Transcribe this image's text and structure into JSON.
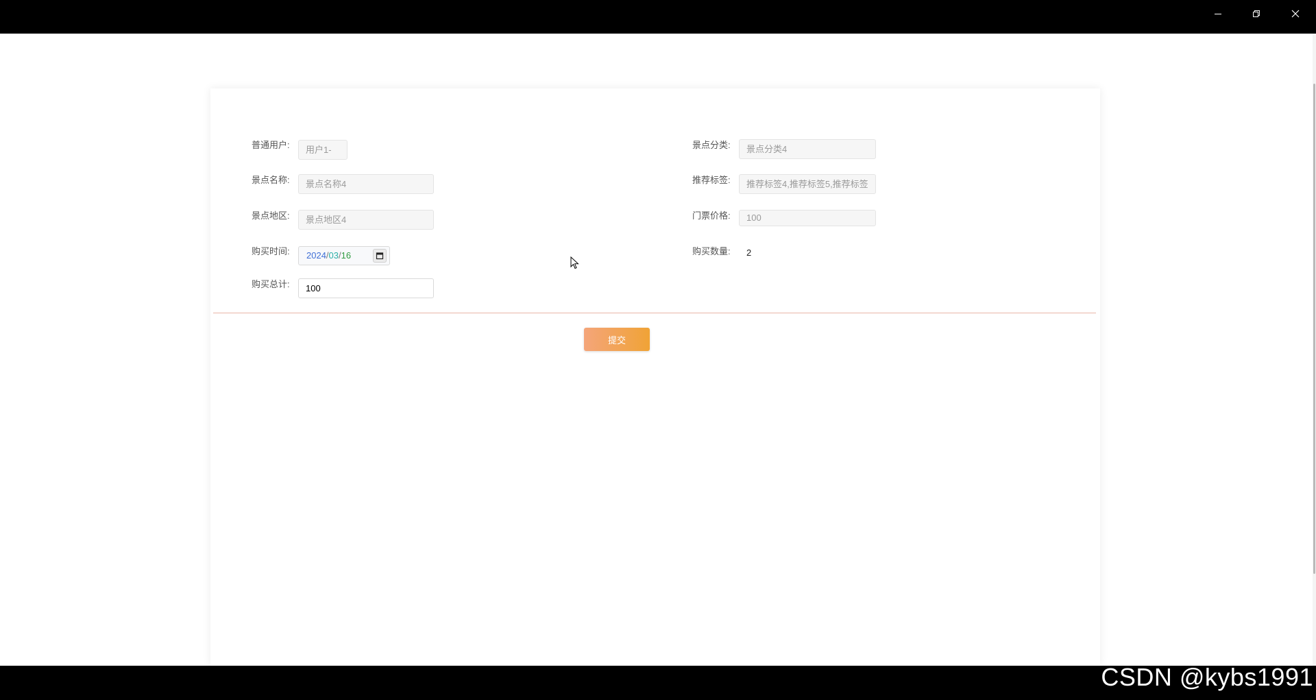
{
  "window": {
    "minimize_icon": "minimize-icon",
    "restore_icon": "restore-icon",
    "close_icon": "close-icon"
  },
  "form": {
    "left": [
      {
        "label": "普通用户:",
        "value": "用户1-",
        "type": "readonly"
      },
      {
        "label": "景点名称:",
        "value": "景点名称4",
        "type": "readonly"
      },
      {
        "label": "景点地区:",
        "value": "景点地区4",
        "type": "readonly"
      },
      {
        "label": "购买时间:",
        "value": "2024/03/16",
        "type": "date"
      },
      {
        "label": "购买总计:",
        "value": "100",
        "type": "editable"
      }
    ],
    "right": [
      {
        "label": "景点分类:",
        "value": "景点分类4",
        "type": "readonly"
      },
      {
        "label": "推荐标签:",
        "value": "推荐标签4,推荐标签5,推荐标签",
        "type": "readonly"
      },
      {
        "label": "门票价格:",
        "value": "100",
        "type": "readonly"
      },
      {
        "label": "购买数量:",
        "value": "2",
        "type": "plain"
      }
    ],
    "date_parts": {
      "year": "2024",
      "month": "03",
      "day": "16",
      "sep": "/"
    },
    "calendar_icon": "calendar-icon"
  },
  "actions": {
    "submit_label": "提交"
  },
  "colors": {
    "accent_start": "#f4a57a",
    "accent_end": "#f0a336",
    "divider": "#e9b5a6"
  },
  "watermark": "CSDN @kybs1991"
}
